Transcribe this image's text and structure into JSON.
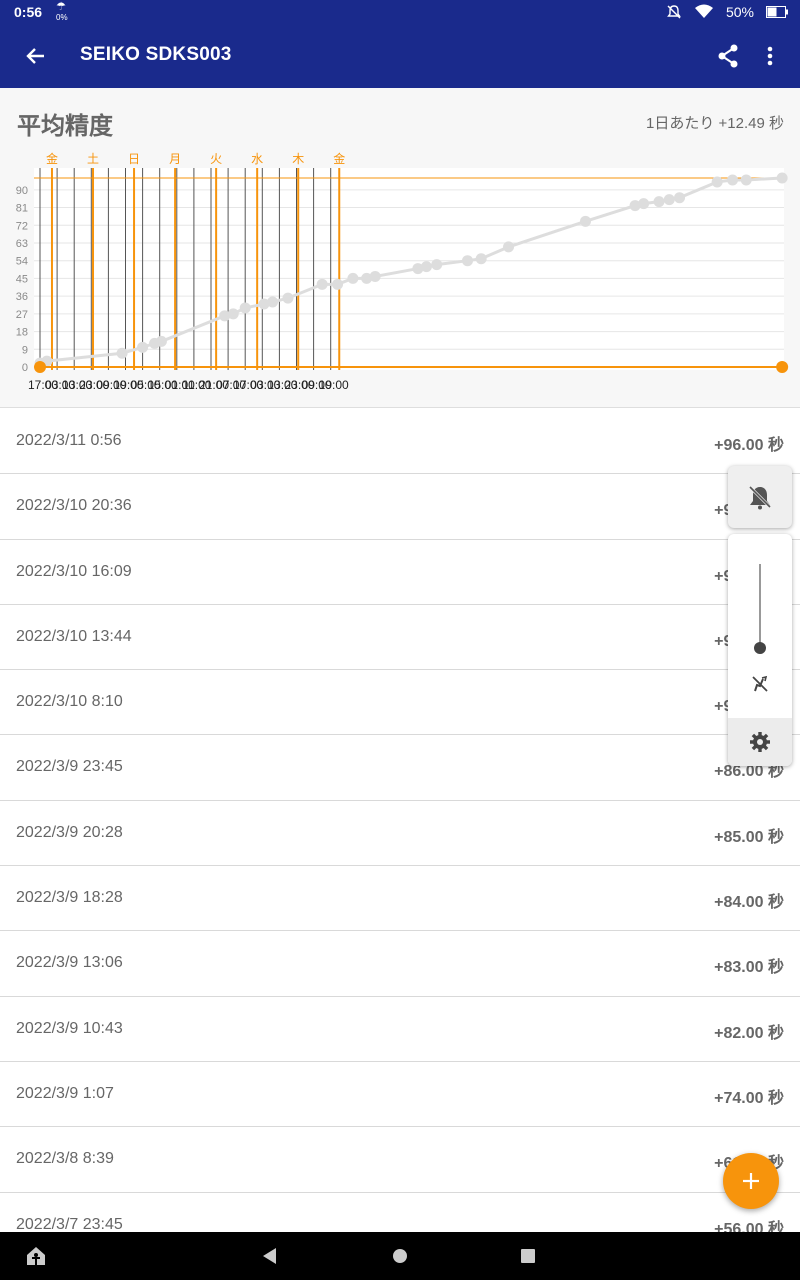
{
  "status_bar": {
    "time": "0:56",
    "weather_top": "☂",
    "weather_bottom": "0%",
    "battery": "50%"
  },
  "app_bar": {
    "title": "SEIKO SDKS003",
    "back_icon": "back-arrow-icon",
    "share_icon": "share-icon",
    "more_icon": "more-vertical-icon",
    "color": "#1a2a8c"
  },
  "chart_section": {
    "title": "平均精度",
    "rate": "1日あたり +12.49 秒"
  },
  "chart_data": {
    "type": "line",
    "y_ticks": [
      "0",
      "9",
      "18",
      "27",
      "36",
      "45",
      "54",
      "63",
      "72",
      "81",
      "90"
    ],
    "ylim": [
      0,
      96
    ],
    "x_tick_labels": [
      "17:00",
      "03:00",
      "13:00",
      "23:00",
      "09:00",
      "19:00",
      "05:00",
      "15:00",
      "01:00",
      "11:00",
      "21:00",
      "07:00",
      "17:00",
      "03:00",
      "13:00",
      "23:00",
      "09:00",
      "19:00"
    ],
    "day_labels": [
      "金",
      "土",
      "日",
      "月",
      "火",
      "水",
      "木",
      "金"
    ],
    "series": [
      {
        "hours_from_start": [
          0,
          4,
          48,
          60,
          67,
          71,
          108,
          113,
          120,
          131,
          136,
          145,
          165,
          174,
          183,
          191,
          196,
          221,
          226,
          232,
          250,
          258,
          274,
          319,
          348,
          353,
          362,
          368,
          374,
          396,
          405,
          413,
          434
        ],
        "values": [
          2,
          3,
          7,
          10,
          12,
          13,
          26,
          27,
          30,
          32,
          33,
          35,
          42,
          42,
          45,
          45,
          46,
          50,
          51,
          52,
          54,
          55,
          61,
          74,
          82,
          83,
          84,
          85,
          86,
          94,
          95,
          95,
          96
        ],
        "color": "#dddddd"
      }
    ],
    "reference_line_value": 0,
    "accent_color": "#f7940c",
    "grid": true
  },
  "list": {
    "unit": "秒",
    "rows": [
      {
        "date": "2022/3/11 0:56",
        "value": "+96.00 秒"
      },
      {
        "date": "2022/3/10 20:36",
        "value": "+95.00 秒"
      },
      {
        "date": "2022/3/10 16:09",
        "value": "+95.00 秒"
      },
      {
        "date": "2022/3/10 13:44",
        "value": "+94.00 秒"
      },
      {
        "date": "2022/3/10 8:10",
        "value": "+94.00 秒"
      },
      {
        "date": "2022/3/9 23:45",
        "value": "+86.00 秒"
      },
      {
        "date": "2022/3/9 20:28",
        "value": "+85.00 秒"
      },
      {
        "date": "2022/3/9 18:28",
        "value": "+84.00 秒"
      },
      {
        "date": "2022/3/9 13:06",
        "value": "+83.00 秒"
      },
      {
        "date": "2022/3/9 10:43",
        "value": "+82.00 秒"
      },
      {
        "date": "2022/3/9 1:07",
        "value": "+74.00 秒"
      },
      {
        "date": "2022/3/8 8:39",
        "value": "+61.00 秒"
      },
      {
        "date": "2022/3/7 23:45",
        "value": "+56.00 秒"
      }
    ]
  },
  "side_panel": {
    "mute_icon": "bell-off-icon",
    "slider_level": 0,
    "slider_icon": "vibrate-off-icon",
    "settings_icon": "gear-icon"
  },
  "fab": {
    "icon": "plus-icon",
    "color": "#f7940c"
  },
  "nav_bar": {
    "icons": [
      "home-accessibility-icon",
      "back-triangle-icon",
      "home-circle-icon",
      "recents-square-icon"
    ]
  }
}
